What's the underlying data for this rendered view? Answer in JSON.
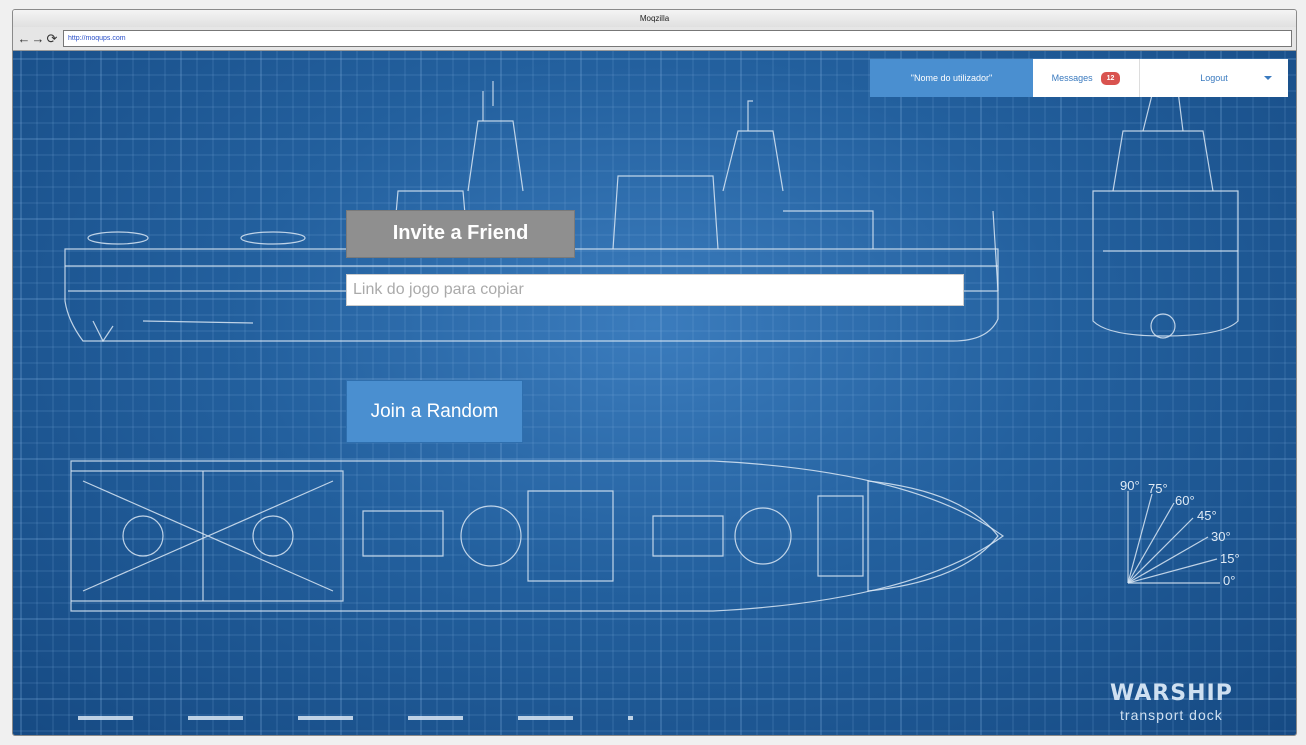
{
  "browser": {
    "title": "Moqzilla",
    "url": "http://moqups.com",
    "back_icon": "arrow-left-icon",
    "forward_icon": "arrow-right-icon",
    "reload_icon": "reload-icon"
  },
  "userbar": {
    "username": "\"Nome do utilizador\"",
    "messages_label": "Messages",
    "messages_count": "12",
    "logout_label": "Logout"
  },
  "actions": {
    "invite_label": "Invite a Friend",
    "link_placeholder": "Link do jogo para copiar",
    "link_value": "",
    "random_label": "Join a Random"
  },
  "blueprint": {
    "brand_title": "WARSHIP",
    "brand_subtitle": "transport dock",
    "angles": [
      "90°",
      "75°",
      "60°",
      "45°",
      "30°",
      "15°",
      "0°"
    ]
  },
  "colors": {
    "primary": "#4a8fd0",
    "secondary": "#8f8f8f",
    "badge": "#d9534f",
    "blueprint_bg": "#23609e"
  }
}
